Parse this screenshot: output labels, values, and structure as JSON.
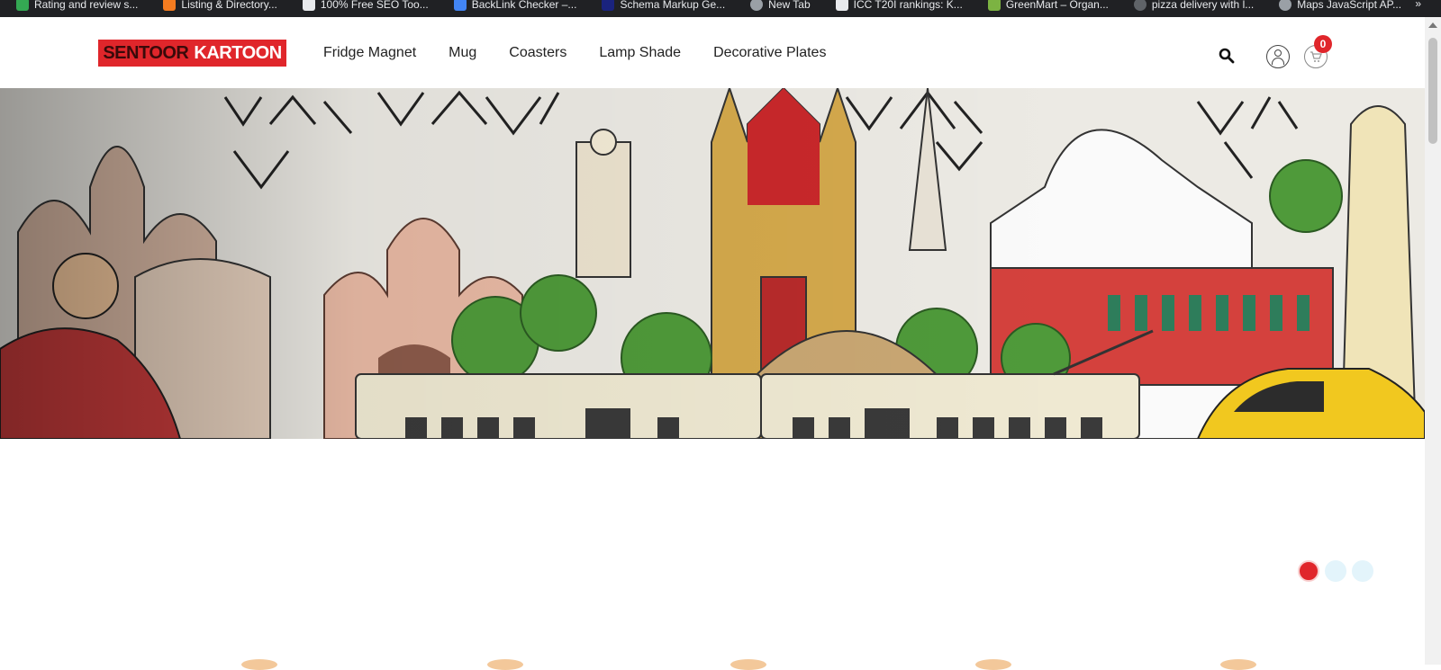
{
  "bookmarks": [
    {
      "label": "Rating and review s...",
      "color": "#34a853"
    },
    {
      "label": "Listing & Directory...",
      "color": "#f47c20"
    },
    {
      "label": "100% Free SEO Too...",
      "color": "#e8eaed"
    },
    {
      "label": "BackLink Checker –...",
      "color": "#4285f4"
    },
    {
      "label": "Schema Markup Ge...",
      "color": "#1a237e"
    },
    {
      "label": "New Tab",
      "color": "#9aa0a6"
    },
    {
      "label": "ICC T20I rankings: K...",
      "color": "#e8eaed"
    },
    {
      "label": "GreenMart – Organ...",
      "color": "#7cb342"
    },
    {
      "label": "pizza delivery with l...",
      "color": "#5f6368"
    },
    {
      "label": "Maps JavaScript AP...",
      "color": "#9aa0a6"
    }
  ],
  "bookmarks_more": "»",
  "header": {
    "logo_part1": "SENTOOR",
    "logo_part2": "KARTOON",
    "nav": [
      "Fridge Magnet",
      "Mug",
      "Coasters",
      "Lamp Shade",
      "Decorative Plates"
    ],
    "cart_count": "0",
    "icons": {
      "search": "search-icon",
      "account": "user-icon",
      "cart": "cart-icon"
    }
  },
  "hero": {
    "image": "kolkata-landmarks-illustration"
  },
  "slider": {
    "total": 3,
    "active": 1
  },
  "colors": {
    "brand_red": "#e0262b",
    "dot_inactive": "#e3f4fb"
  }
}
